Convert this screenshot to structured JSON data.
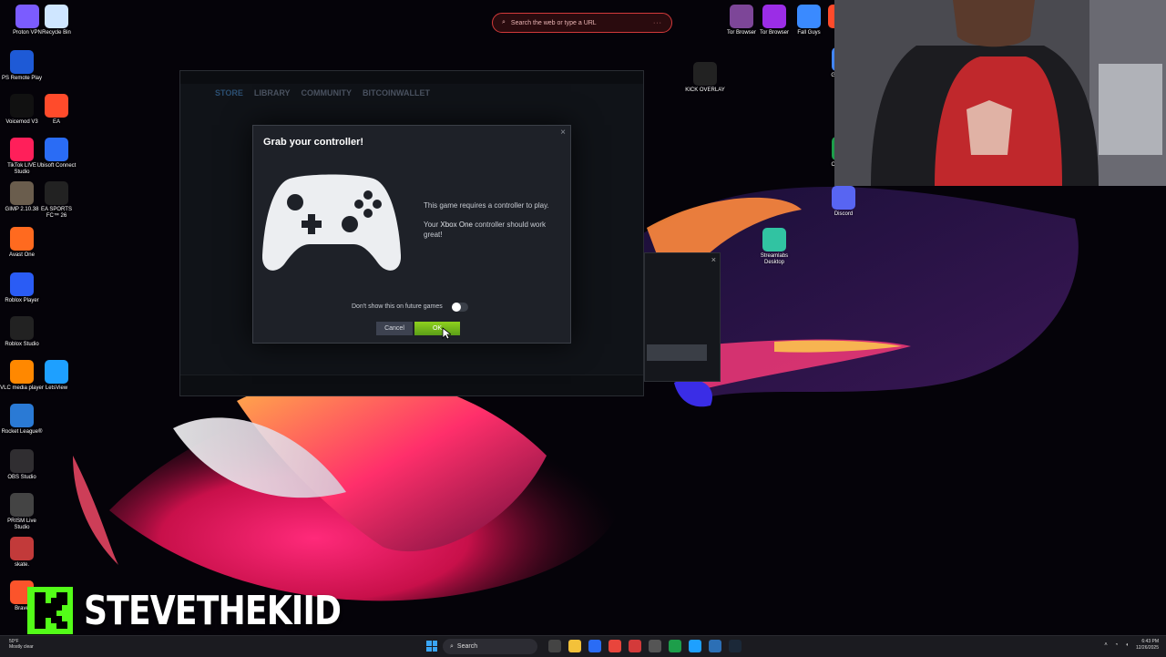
{
  "browser": {
    "address_placeholder": "Search the web or type a URL",
    "menu_dots": "···"
  },
  "desktop_icons": [
    {
      "label": "Proton VPN",
      "color": "#7b5cff"
    },
    {
      "label": "Recycle Bin",
      "color": "#cfe6ff"
    },
    {
      "label": "PS Remote Play",
      "color": "#1e5ad6"
    },
    {
      "label": "Voicemod V3",
      "color": "#111111"
    },
    {
      "label": "EA",
      "color": "#ff4b2b"
    },
    {
      "label": "TikTok LIVE Studio",
      "color": "#ff1f5a"
    },
    {
      "label": "Ubisoft Connect",
      "color": "#2a6cf5"
    },
    {
      "label": "GIMP 2.10.38",
      "color": "#6a5d4d"
    },
    {
      "label": "EA SPORTS FC™ 26",
      "color": "#222222"
    },
    {
      "label": "Avast One",
      "color": "#ff6a1f"
    },
    {
      "label": "Roblox Player",
      "color": "#2a5cf5"
    },
    {
      "label": "Roblox Studio",
      "color": "#222222"
    },
    {
      "label": "VLC media player",
      "color": "#ff8800"
    },
    {
      "label": "LetsView",
      "color": "#1ea0ff"
    },
    {
      "label": "Rocket League®",
      "color": "#2a7ad5"
    },
    {
      "label": "OBS Studio",
      "color": "#302e31"
    },
    {
      "label": "PRISM Live Studio",
      "color": "#444444"
    },
    {
      "label": "skate.",
      "color": "#c23a3a"
    },
    {
      "label": "Brave",
      "color": "#fb542b"
    }
  ],
  "top_right_icons": [
    {
      "label": "Tor Browser",
      "color": "#7d4698"
    },
    {
      "label": "Tor Browser",
      "color": "#9b2de6"
    },
    {
      "label": "Fall Guys",
      "color": "#3a8aff"
    },
    {
      "label": "Fi...",
      "color": "#ff4b2b"
    },
    {
      "label": "KICK OVERLAY",
      "color": "#222222"
    },
    {
      "label": "Streamlabs Desktop",
      "color": "#31c3a2"
    },
    {
      "label": "Discord",
      "color": "#5865f2"
    },
    {
      "label": "Co... Ne...",
      "color": "#1d9e4a"
    },
    {
      "label": "Go... Ch...",
      "color": "#4285f4"
    }
  ],
  "steam": {
    "nav": [
      "STORE",
      "LIBRARY",
      "COMMUNITY",
      "BITCOINWALLET"
    ]
  },
  "dialog": {
    "title": "Grab your controller!",
    "close_icon": "×",
    "message1": "This game requires a controller to play.",
    "message2_prefix": "Your ",
    "message2_highlight": "Xbox One",
    "message2_suffix": " controller should work great!",
    "toggle_label": "Don't show this on future games",
    "toggle_on": false,
    "cancel_label": "Cancel",
    "ok_label": "OK"
  },
  "small_dialog": {
    "close_icon": "×"
  },
  "banner": {
    "name": "STEVETHEKIID"
  },
  "taskbar": {
    "weather_temp": "50°F",
    "weather_desc": "Mostly clear",
    "search_label": "Search",
    "time": "6:43 PM",
    "date": "12/26/2025",
    "accent": "#3aa5f5"
  },
  "colors": {
    "ok_green": "#6cb81a",
    "kick_green": "#53fc18",
    "dialog_bg": "#1e2128"
  }
}
